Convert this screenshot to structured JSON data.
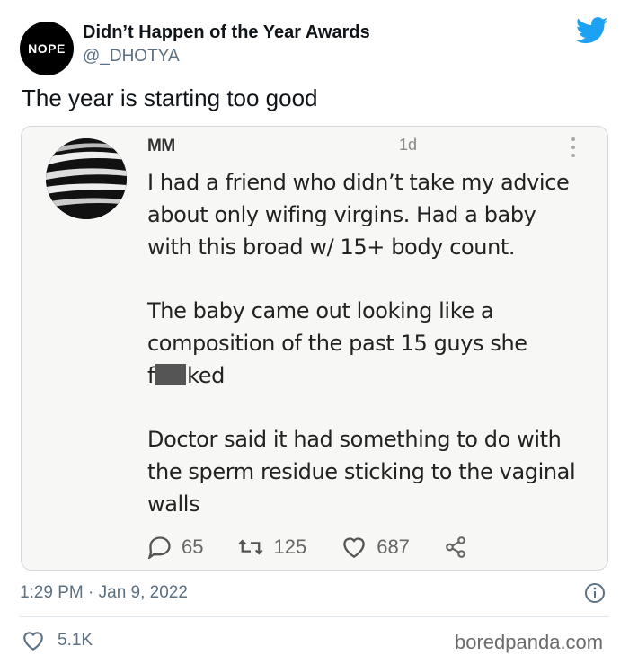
{
  "tweet": {
    "author": {
      "avatar_text": "NOPE",
      "name": "Didn’t Happen of the Year Awards",
      "handle": "@_DHOTYA"
    },
    "platform_icon": "twitter-bird-icon",
    "text": "The year is starting too good",
    "timestamp": "1:29 PM · Jan 9, 2022",
    "likes": "5.1K",
    "accent_color": "#1da1f2"
  },
  "embedded_post": {
    "name": "MM",
    "time": "1d",
    "paragraphs": [
      [
        "I had a friend who didn’t take my advice",
        "about only wifing virgins. Had a baby",
        "with this broad w/ 15+ body count."
      ],
      [
        "The baby came out looking like a",
        "composition of the past 15 guys she"
      ],
      [
        "Doctor said it had something to do with",
        "the sperm residue sticking to the vaginal",
        "walls"
      ]
    ],
    "redacted_word": {
      "before": "f",
      "after": "ked"
    },
    "replies": "65",
    "retweets": "125",
    "likes": "687"
  },
  "watermark": "boredpanda.com"
}
